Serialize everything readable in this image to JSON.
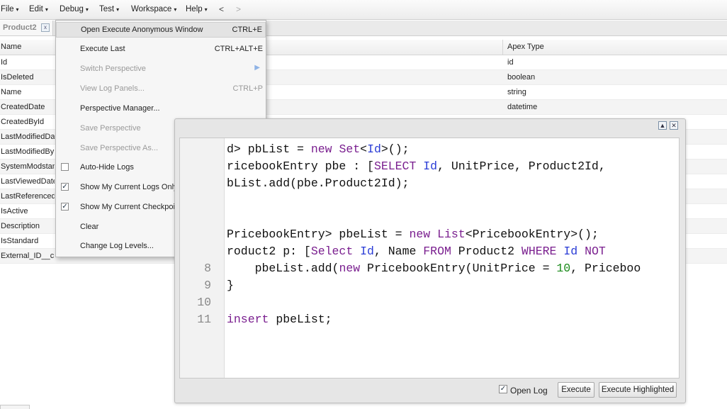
{
  "menubar": {
    "items": [
      "File",
      "Edit",
      "Debug",
      "Test",
      "Workspace",
      "Help"
    ],
    "back": "<",
    "forward": ">"
  },
  "tab": {
    "label": "Product2",
    "close": "x"
  },
  "table": {
    "columns": [
      "Name",
      "Apex Type"
    ],
    "rows": [
      {
        "name": "Id",
        "type": "id"
      },
      {
        "name": "IsDeleted",
        "type": "boolean"
      },
      {
        "name": "Name",
        "type": "string"
      },
      {
        "name": "CreatedDate",
        "type": "datetime"
      },
      {
        "name": "CreatedById",
        "type": ""
      },
      {
        "name": "LastModifiedDate",
        "type": ""
      },
      {
        "name": "LastModifiedById",
        "type": ""
      },
      {
        "name": "SystemModstamp",
        "type": ""
      },
      {
        "name": "LastViewedDate",
        "type": ""
      },
      {
        "name": "LastReferencedDate",
        "type": ""
      },
      {
        "name": "IsActive",
        "type": ""
      },
      {
        "name": "Description",
        "type": ""
      },
      {
        "name": "IsStandard",
        "type": ""
      },
      {
        "name": "External_ID__c",
        "type": ""
      }
    ]
  },
  "debug_menu": {
    "items": [
      {
        "label": "Open Execute Anonymous Window",
        "shortcut": "CTRL+E",
        "state": "highlight"
      },
      {
        "label": "Execute Last",
        "shortcut": "CTRL+ALT+E",
        "state": "enabled"
      },
      {
        "label": "Switch Perspective",
        "shortcut": "",
        "state": "disabled",
        "submenu": true
      },
      {
        "label": "View Log Panels...",
        "shortcut": "CTRL+P",
        "state": "disabled"
      },
      {
        "label": "Perspective Manager...",
        "shortcut": "",
        "state": "enabled"
      },
      {
        "label": "Save Perspective",
        "shortcut": "",
        "state": "disabled"
      },
      {
        "label": "Save Perspective As...",
        "shortcut": "",
        "state": "disabled"
      },
      {
        "label": "Auto-Hide Logs",
        "shortcut": "",
        "state": "enabled",
        "checkbox": false
      },
      {
        "label": "Show My Current Logs Only",
        "shortcut": "",
        "state": "enabled",
        "checkbox": true
      },
      {
        "label": "Show My Current Checkpoints Only",
        "shortcut": "",
        "state": "enabled",
        "checkbox": true
      },
      {
        "label": "Clear",
        "shortcut": "",
        "state": "enabled",
        "submenu": true
      },
      {
        "label": "Change Log Levels...",
        "shortcut": "",
        "state": "enabled"
      }
    ]
  },
  "execute_window": {
    "code_lines": [
      {
        "n": "",
        "parts": [
          [
            "",
            "d> pbList = "
          ],
          [
            "kw",
            "new"
          ],
          [
            "",
            " "
          ],
          [
            "kw",
            "Set"
          ],
          [
            "",
            "<"
          ],
          [
            "ty",
            "Id"
          ],
          [
            "",
            ">();"
          ]
        ]
      },
      {
        "n": "",
        "parts": [
          [
            "",
            "ricebookEntry pbe : ["
          ],
          [
            "kw",
            "SELECT"
          ],
          [
            "",
            " "
          ],
          [
            "ty",
            "Id"
          ],
          [
            "",
            ", UnitPrice, Product2Id,"
          ]
        ]
      },
      {
        "n": "",
        "parts": [
          [
            "",
            "bList.add(pbe.Product2Id);"
          ]
        ]
      },
      {
        "n": "",
        "parts": [
          [
            "",
            ""
          ]
        ]
      },
      {
        "n": "",
        "parts": [
          [
            "",
            ""
          ]
        ]
      },
      {
        "n": "",
        "parts": [
          [
            "",
            "PricebookEntry> pbeList = "
          ],
          [
            "kw",
            "new"
          ],
          [
            "",
            " "
          ],
          [
            "kw",
            "List"
          ],
          [
            "",
            "<PricebookEntry>();"
          ]
        ]
      },
      {
        "n": "",
        "parts": [
          [
            "",
            "roduct2 p: ["
          ],
          [
            "kw",
            "Select"
          ],
          [
            "",
            " "
          ],
          [
            "ty",
            "Id"
          ],
          [
            "",
            ", Name "
          ],
          [
            "kw",
            "FROM"
          ],
          [
            "",
            " Product2 "
          ],
          [
            "kw",
            "WHERE"
          ],
          [
            "",
            " "
          ],
          [
            "ty",
            "Id"
          ],
          [
            "",
            " "
          ],
          [
            "kw",
            "NOT"
          ]
        ]
      },
      {
        "n": "8",
        "parts": [
          [
            "",
            "    pbeList.add("
          ],
          [
            "kw",
            "new"
          ],
          [
            "",
            " PricebookEntry(UnitPrice = "
          ],
          [
            "num",
            "10"
          ],
          [
            "",
            ", Priceboo"
          ]
        ]
      },
      {
        "n": "9",
        "parts": [
          [
            "",
            "}"
          ]
        ]
      },
      {
        "n": "10",
        "parts": [
          [
            "",
            ""
          ]
        ]
      },
      {
        "n": "11",
        "parts": [
          [
            "kw",
            "insert"
          ],
          [
            "",
            " pbeList;"
          ]
        ]
      }
    ],
    "open_log_label": "Open Log",
    "open_log_checked": true,
    "execute_label": "Execute",
    "execute_highlighted_label": "Execute Highlighted"
  }
}
